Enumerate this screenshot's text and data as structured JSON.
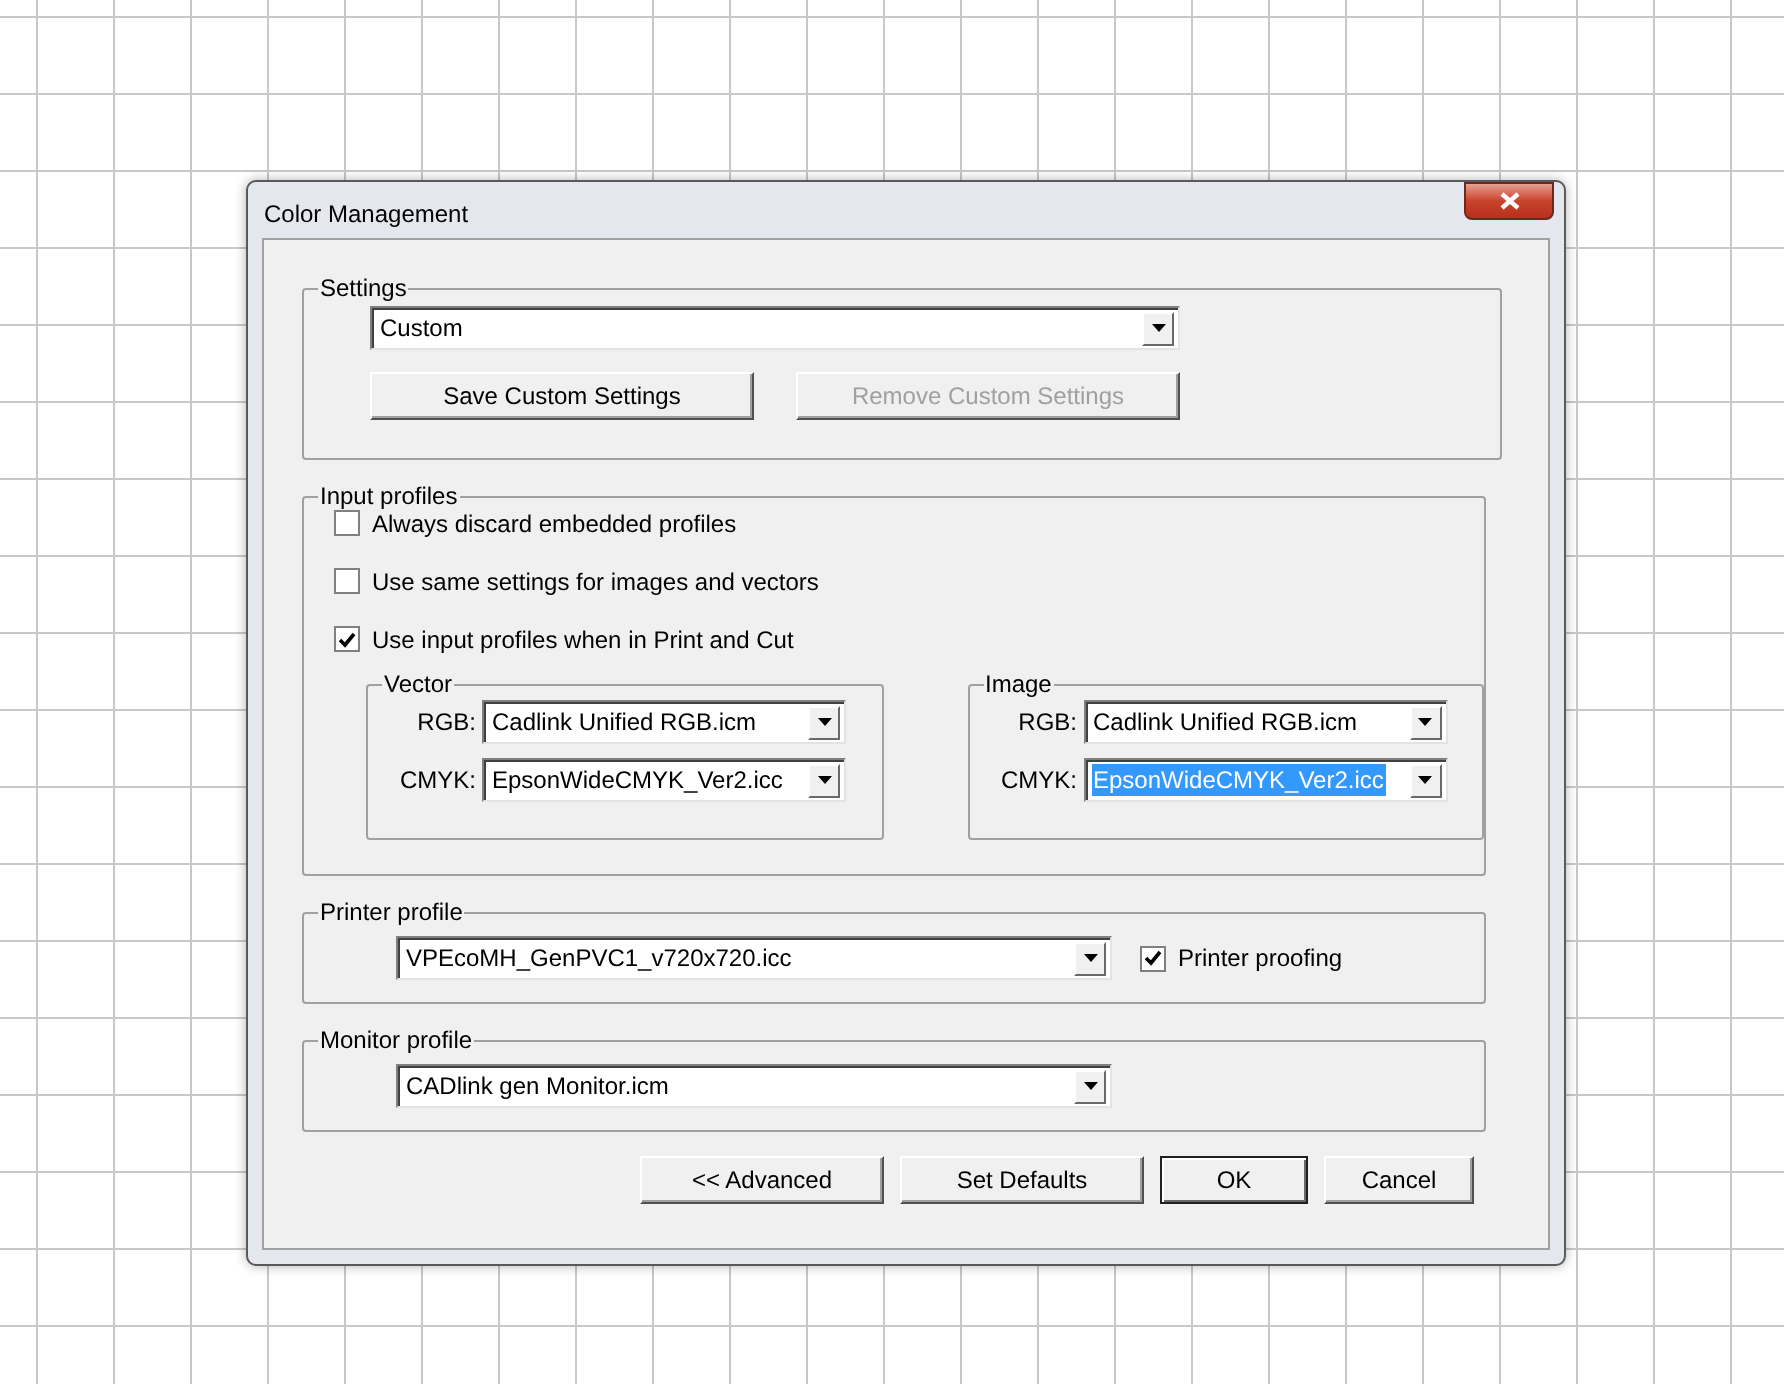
{
  "window": {
    "title": "Color Management"
  },
  "settings": {
    "label": "Settings",
    "preset": "Custom",
    "buttons": [
      {
        "label": "Save Custom Settings",
        "disabled": false
      },
      {
        "label": "Remove Custom Settings",
        "disabled": true
      }
    ]
  },
  "input_profiles": {
    "label": "Input profiles",
    "options": [
      {
        "label": "Always discard embedded profiles",
        "checked": false
      },
      {
        "label": "Use same settings for images and vectors",
        "checked": false
      },
      {
        "label": "Use input profiles when in Print and Cut",
        "checked": true
      }
    ],
    "groups": [
      {
        "label": "Vector",
        "rows": [
          {
            "label": "RGB:",
            "value": "Cadlink Unified RGB.icm",
            "selected": false
          },
          {
            "label": "CMYK:",
            "value": "EpsonWideCMYK_Ver2.icc",
            "selected": false
          }
        ]
      },
      {
        "label": "Image",
        "rows": [
          {
            "label": "RGB:",
            "value": "Cadlink Unified RGB.icm",
            "selected": false
          },
          {
            "label": "CMYK:",
            "value": "EpsonWideCMYK_Ver2.icc",
            "selected": true
          }
        ]
      }
    ]
  },
  "printer_profile": {
    "label": "Printer profile",
    "value": "VPEcoMH_GenPVC1_v720x720.icc",
    "proofing": {
      "label": "Printer proofing",
      "checked": true
    }
  },
  "monitor_profile": {
    "label": "Monitor profile",
    "value": "CADlink gen Monitor.icm"
  },
  "buttons": [
    {
      "label": "<< Advanced",
      "default": false
    },
    {
      "label": "Set Defaults",
      "default": false
    },
    {
      "label": "OK",
      "default": true
    },
    {
      "label": "Cancel",
      "default": false
    }
  ]
}
